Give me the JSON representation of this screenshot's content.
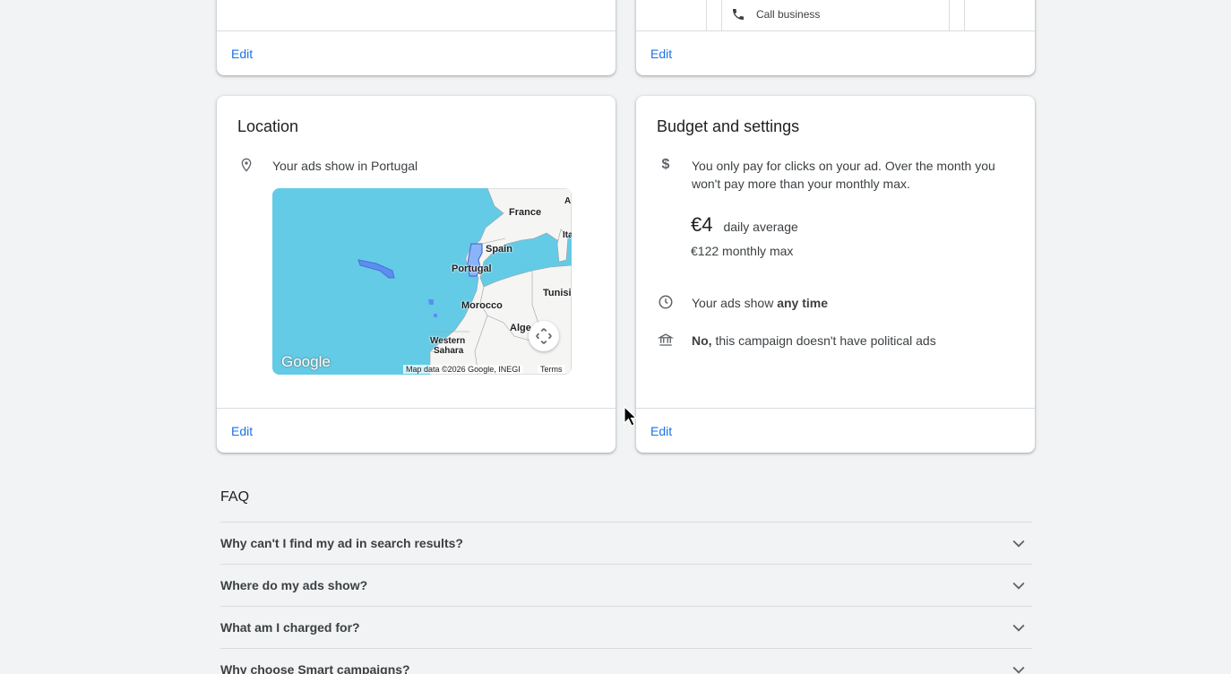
{
  "top_cards": {
    "left_edit": "Edit",
    "right_edit": "Edit",
    "call_business": "Call business"
  },
  "location_card": {
    "title": "Location",
    "ads_location": "Your ads show in Portugal",
    "map": {
      "labels": [
        "France",
        "Spain",
        "Portugal",
        "Morocco",
        "Alge",
        "Tunisi",
        "Western",
        "Sahara",
        "A",
        "Ita"
      ],
      "logo": "Google",
      "attribution": "Map data ©2026 Google, INEGI",
      "terms": "Terms"
    },
    "edit": "Edit"
  },
  "budget_card": {
    "title": "Budget and settings",
    "pay_info": "You only pay for clicks on your ad. Over the month you won't pay more than your monthly max.",
    "daily_amount": "€4",
    "daily_label": "daily average",
    "monthly_max": "€122 monthly max",
    "schedule_prefix": "Your ads show ",
    "schedule_bold": "any time",
    "political_bold": "No,",
    "political_rest": " this campaign doesn't have political ads",
    "edit": "Edit"
  },
  "faq": {
    "title": "FAQ",
    "items": [
      "Why can't I find my ad in search results?",
      "Where do my ads show?",
      "What am I charged for?",
      "Why choose Smart campaigns?"
    ]
  },
  "colors": {
    "link": "#1a73e8",
    "map_water": "#63cbe5",
    "background": "#f1f3f4"
  }
}
